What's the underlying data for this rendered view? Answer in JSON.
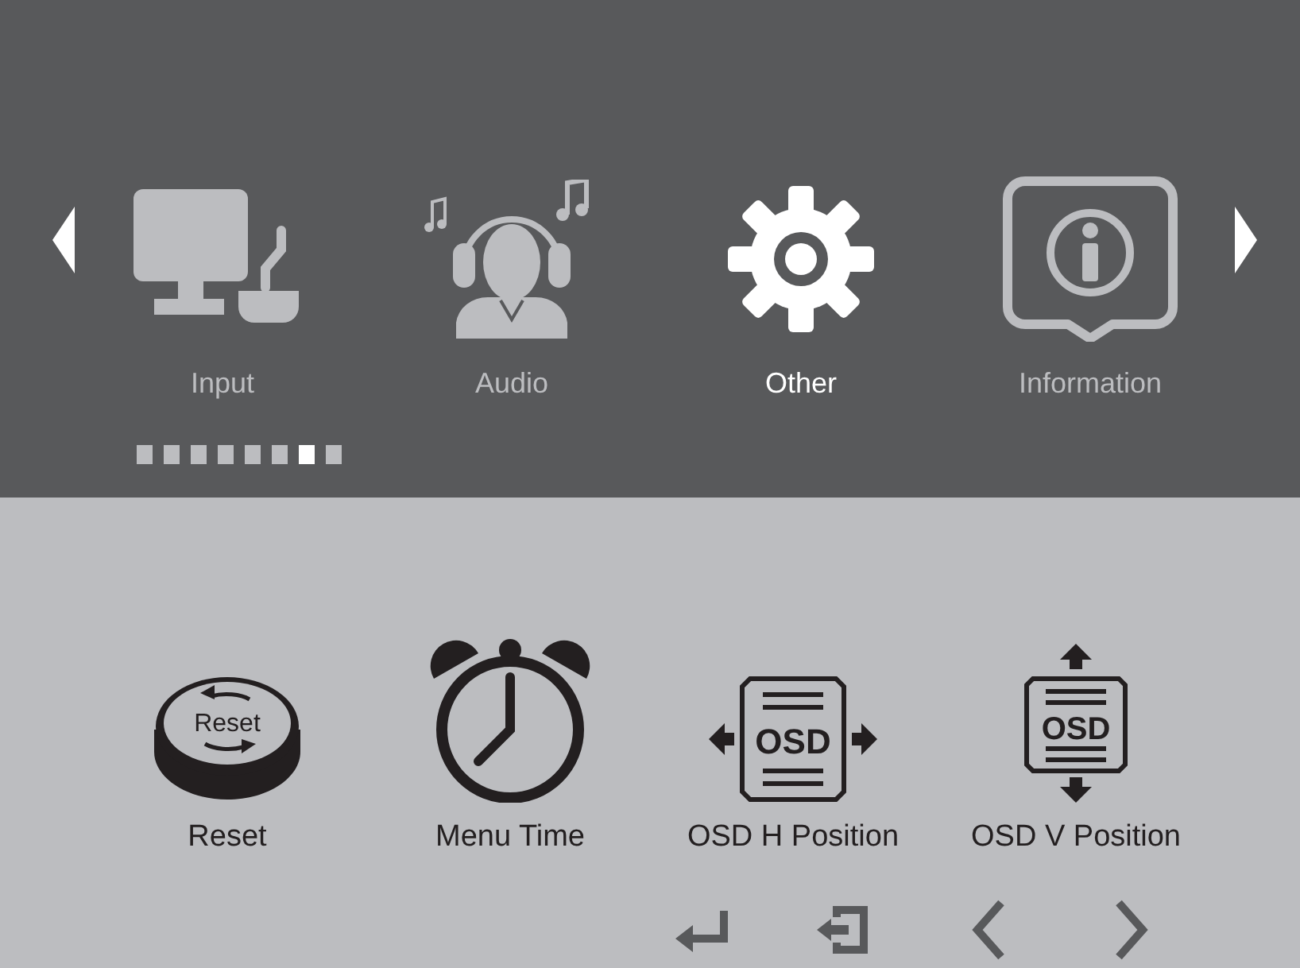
{
  "tabs": [
    {
      "kind": "input",
      "label": "Input",
      "selected": false
    },
    {
      "kind": "audio",
      "label": "Audio",
      "selected": false
    },
    {
      "kind": "settings",
      "label": "Other",
      "selected": true
    },
    {
      "kind": "info",
      "label": "Information",
      "selected": false
    }
  ],
  "page_dots": [
    {
      "selected": false
    },
    {
      "selected": false
    },
    {
      "selected": false
    },
    {
      "selected": false
    },
    {
      "selected": false
    },
    {
      "selected": false
    },
    {
      "selected": true
    },
    {
      "selected": false
    }
  ],
  "items": [
    {
      "kind": "reset",
      "label": "Reset",
      "icon_text": "Reset"
    },
    {
      "kind": "clock",
      "label": "Menu Time"
    },
    {
      "kind": "osd_h",
      "label": "OSD H Position",
      "icon_text": "OSD"
    },
    {
      "kind": "osd_v",
      "label": "OSD V Position",
      "icon_text": "OSD"
    }
  ],
  "footer_buttons": [
    {
      "kind": "enter"
    },
    {
      "kind": "exit"
    },
    {
      "kind": "left"
    },
    {
      "kind": "right"
    }
  ]
}
